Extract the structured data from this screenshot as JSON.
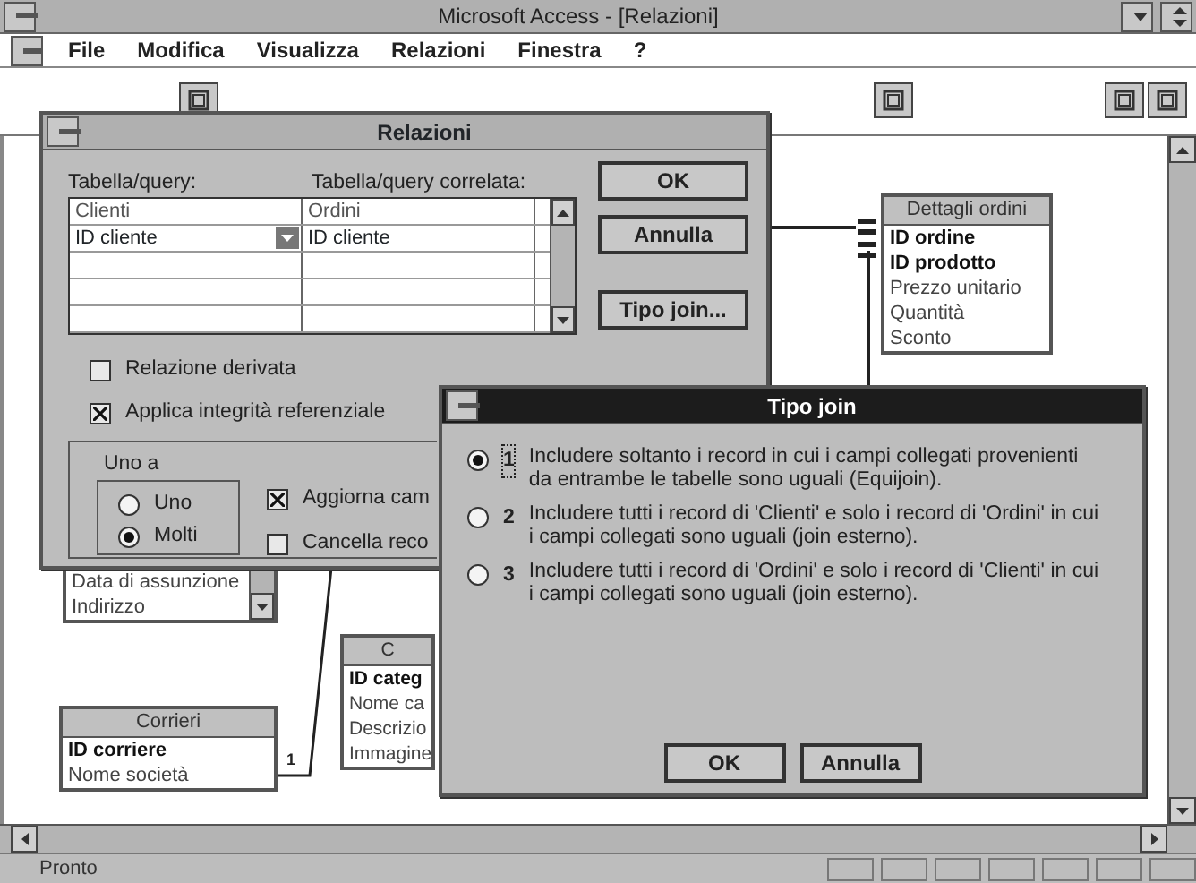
{
  "window": {
    "title": "Microsoft Access - [Relazioni]"
  },
  "menu": [
    "File",
    "Modifica",
    "Visualizza",
    "Relazioni",
    "Finestra",
    "?"
  ],
  "tables": [
    {
      "title": "Dettagli ordini",
      "fields": [
        {
          "name": "ID ordine",
          "key": true
        },
        {
          "name": "ID prodotto",
          "key": true
        },
        {
          "name": "Prezzo unitario",
          "key": false
        },
        {
          "name": "Quantità",
          "key": false
        },
        {
          "name": "Sconto",
          "key": false
        }
      ]
    },
    {
      "fields": [
        {
          "name": "Data di assunzione",
          "key": false
        },
        {
          "name": "Indirizzo",
          "key": false
        }
      ]
    },
    {
      "title": "Corrieri",
      "fields": [
        {
          "name": "ID corriere",
          "key": true
        },
        {
          "name": "Nome società",
          "key": false
        }
      ]
    },
    {
      "title": "C",
      "fields": [
        {
          "name": "ID categ",
          "key": true
        },
        {
          "name": "Nome ca",
          "key": false
        },
        {
          "name": "Descrizio",
          "key": false
        },
        {
          "name": "Immagine",
          "key": false
        }
      ]
    }
  ],
  "relation_label": "1",
  "relazioni_dialog": {
    "title": "Relazioni",
    "table_label": "Tabella/query:",
    "related_label": "Tabella/query correlata:",
    "grid": {
      "columns": [
        "Clienti",
        "Ordini"
      ],
      "rows": [
        [
          "ID cliente",
          "ID cliente"
        ]
      ]
    },
    "buttons": [
      "OK",
      "Annulla",
      "Tipo join..."
    ],
    "options": [
      {
        "label": "Relazione derivata",
        "checked": false
      },
      {
        "label": "Applica integrità referenziale",
        "checked": true
      }
    ],
    "group": {
      "title": "Uno a",
      "choices": [
        {
          "label": "Uno",
          "selected": false
        },
        {
          "label": "Molti",
          "selected": true
        }
      ]
    },
    "cascade": [
      {
        "label": "Aggiorna cam",
        "checked": true
      },
      {
        "label": "Cancella reco",
        "checked": false
      }
    ]
  },
  "join_dialog": {
    "title": "Tipo join",
    "choices": [
      {
        "number": "1",
        "text": "Includere soltanto i record in cui i campi collegati provenienti da entrambe le tabelle sono uguali (Equijoin).",
        "selected": true
      },
      {
        "number": "2",
        "text": "Includere tutti i record di 'Clienti' e solo i record di 'Ordini' in cui i campi collegati sono uguali (join esterno).",
        "selected": false
      },
      {
        "number": "3",
        "text": "Includere tutti i record di 'Ordini' e solo i record di 'Clienti' in cui i campi collegati sono uguali (join esterno).",
        "selected": false
      }
    ],
    "buttons": [
      "OK",
      "Annulla"
    ]
  },
  "status_bar": {
    "text": "Pronto"
  }
}
